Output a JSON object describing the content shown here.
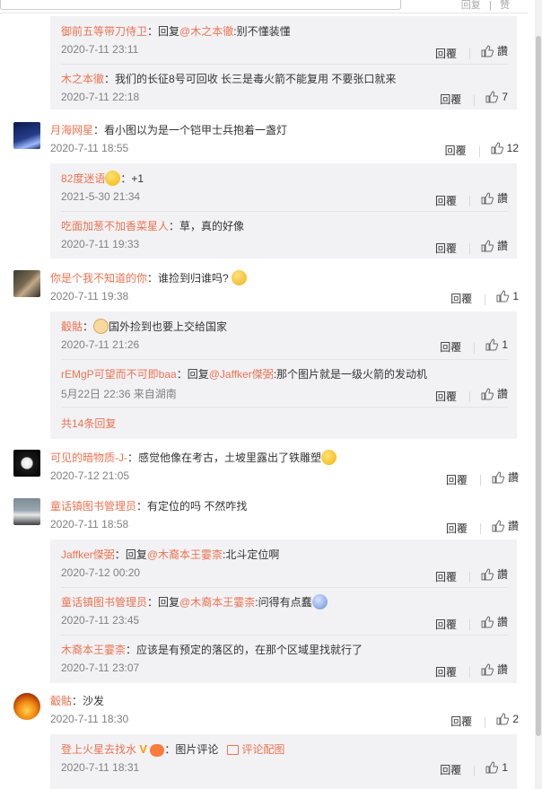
{
  "top_fragment": {
    "reply": "回复",
    "like": "赞"
  },
  "labels": {
    "reply": "回覆",
    "like_text": "讚"
  },
  "colors": {
    "username": "#eb7350",
    "meta": "#808080",
    "sub_background": "#f2f2f5"
  },
  "threads": [
    {
      "subs_top": [
        {
          "user": "御前五等带刀侍卫",
          "sep": "：",
          "prefix": "回复",
          "at": "@木之本徹",
          "text": ":别不懂装懂",
          "time": "2020-7-11 23:11",
          "likes": "讚"
        },
        {
          "user": "木之本徹",
          "sep": "：",
          "text": "我们的长征8号可回收 长三是毒火箭不能复用 不要张口就来",
          "time": "2020-7-11 22:18",
          "likes": "7"
        }
      ]
    },
    {
      "main": {
        "user": "月海网星",
        "sep": "：",
        "text": "看小图以为是一个铠甲士兵抱着一盏灯",
        "time": "2020-7-11 18:55",
        "likes": "12"
      },
      "subs": [
        {
          "user": "82度迷语",
          "sep": "：",
          "text": "+1",
          "time": "2021-5-30 21:34",
          "likes": "讚"
        },
        {
          "user": "吃面加葱不加香菜星人",
          "sep": "：",
          "text": "草，真的好像",
          "time": "2020-7-11 19:33",
          "likes": "讚"
        }
      ]
    },
    {
      "main": {
        "user": "你是个我不知道的你",
        "sep": "：",
        "text": "谁捡到归谁吗?",
        "time": "2020-7-11 19:38",
        "likes": "1"
      },
      "subs": [
        {
          "user": "觳骷",
          "sep": "：",
          "text": "国外捡到也要上交给国家",
          "time": "2020-7-11 21:26",
          "likes": "1"
        },
        {
          "user": "rEMgP可望而不可即baa",
          "sep": "：",
          "prefix": "回复",
          "at": "@Jaffker傑弼",
          "text": ":那个图片就是一级火箭的发动机",
          "time": "5月22日 22:36 来自湖南",
          "likes": "讚"
        }
      ],
      "more": "共14条回复"
    },
    {
      "main": {
        "user": "可见的暗物质-J-",
        "sep": "：",
        "text": "感觉他像在考古，土坡里露出了铁雕塑",
        "time": "2020-7-12 21:05",
        "likes": "讚"
      }
    },
    {
      "main": {
        "user": "童话镇图书管理员",
        "sep": "：",
        "text": "有定位的吗 不然咋找",
        "time": "2020-7-11 18:58",
        "likes": "讚"
      },
      "subs": [
        {
          "user": "Jaffker傑弼",
          "sep": "：",
          "prefix": "回复",
          "at": "@木裔本王霎柰",
          "text": ":北斗定位啊",
          "time": "2020-7-12 00:20",
          "likes": "讚"
        },
        {
          "user": "童话镇图书管理员",
          "sep": "：",
          "prefix": "回复",
          "at": "@木裔本王霎柰",
          "text": ":问得有点蠢",
          "time": "2020-7-11 23:45",
          "likes": "讚"
        },
        {
          "user": "木裔本王霎柰",
          "sep": "：",
          "text": "应该是有预定的落区的，在那个区域里找就行了",
          "time": "2020-7-11 23:07",
          "likes": "讚"
        }
      ]
    },
    {
      "main": {
        "user": "觳骷",
        "sep": "：",
        "text": "沙发",
        "time": "2020-7-11 18:30",
        "likes": "2"
      },
      "subs": [
        {
          "user": "登上火星去找水",
          "sep": "：",
          "text": "图片评论",
          "link": "评论配图",
          "time": "2020-7-11 18:31",
          "likes": "1"
        }
      ]
    }
  ]
}
